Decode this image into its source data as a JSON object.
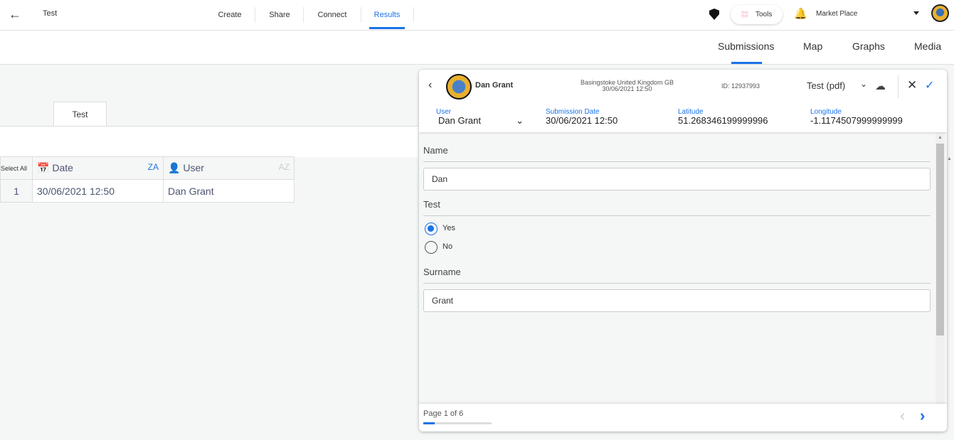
{
  "topbar": {
    "title": "Test",
    "tabs": [
      "Create",
      "Share",
      "Connect",
      "Results"
    ],
    "active_tab": "Results",
    "tools_label": "Tools",
    "marketplace_label": "Market Place"
  },
  "subtabs": [
    "Submissions",
    "Map",
    "Graphs",
    "Media"
  ],
  "active_subtab": "Submissions",
  "form_tab": "Test",
  "table": {
    "select_all": "Select All",
    "columns": [
      "Date",
      "User"
    ],
    "rows": [
      {
        "index": "1",
        "date": "30/06/2021 12:50",
        "user": "Dan Grant"
      }
    ]
  },
  "panel": {
    "user_name": "Dan Grant",
    "location": "Basingstoke United Kingdom GB",
    "datetime": "30/06/2021 12:50",
    "id": "ID: 12937993",
    "export_format": "Test (pdf)",
    "meta": {
      "user_label": "User",
      "user_value": "Dan Grant",
      "date_label": "Submission Date",
      "date_value": "30/06/2021 12:50",
      "lat_label": "Latitude",
      "lat_value": "51.268346199999996",
      "lon_label": "Longitude",
      "lon_value": "-1.1174507999999999"
    },
    "questions": {
      "name_label": "Name",
      "name_value": "Dan",
      "test_label": "Test",
      "options": [
        "Yes",
        "No"
      ],
      "selected": "Yes",
      "surname_label": "Surname",
      "surname_value": "Grant"
    },
    "page_text": "Page 1 of 6",
    "page_progress": 0.1667
  },
  "colors": {
    "accent": "#1a73e8"
  }
}
